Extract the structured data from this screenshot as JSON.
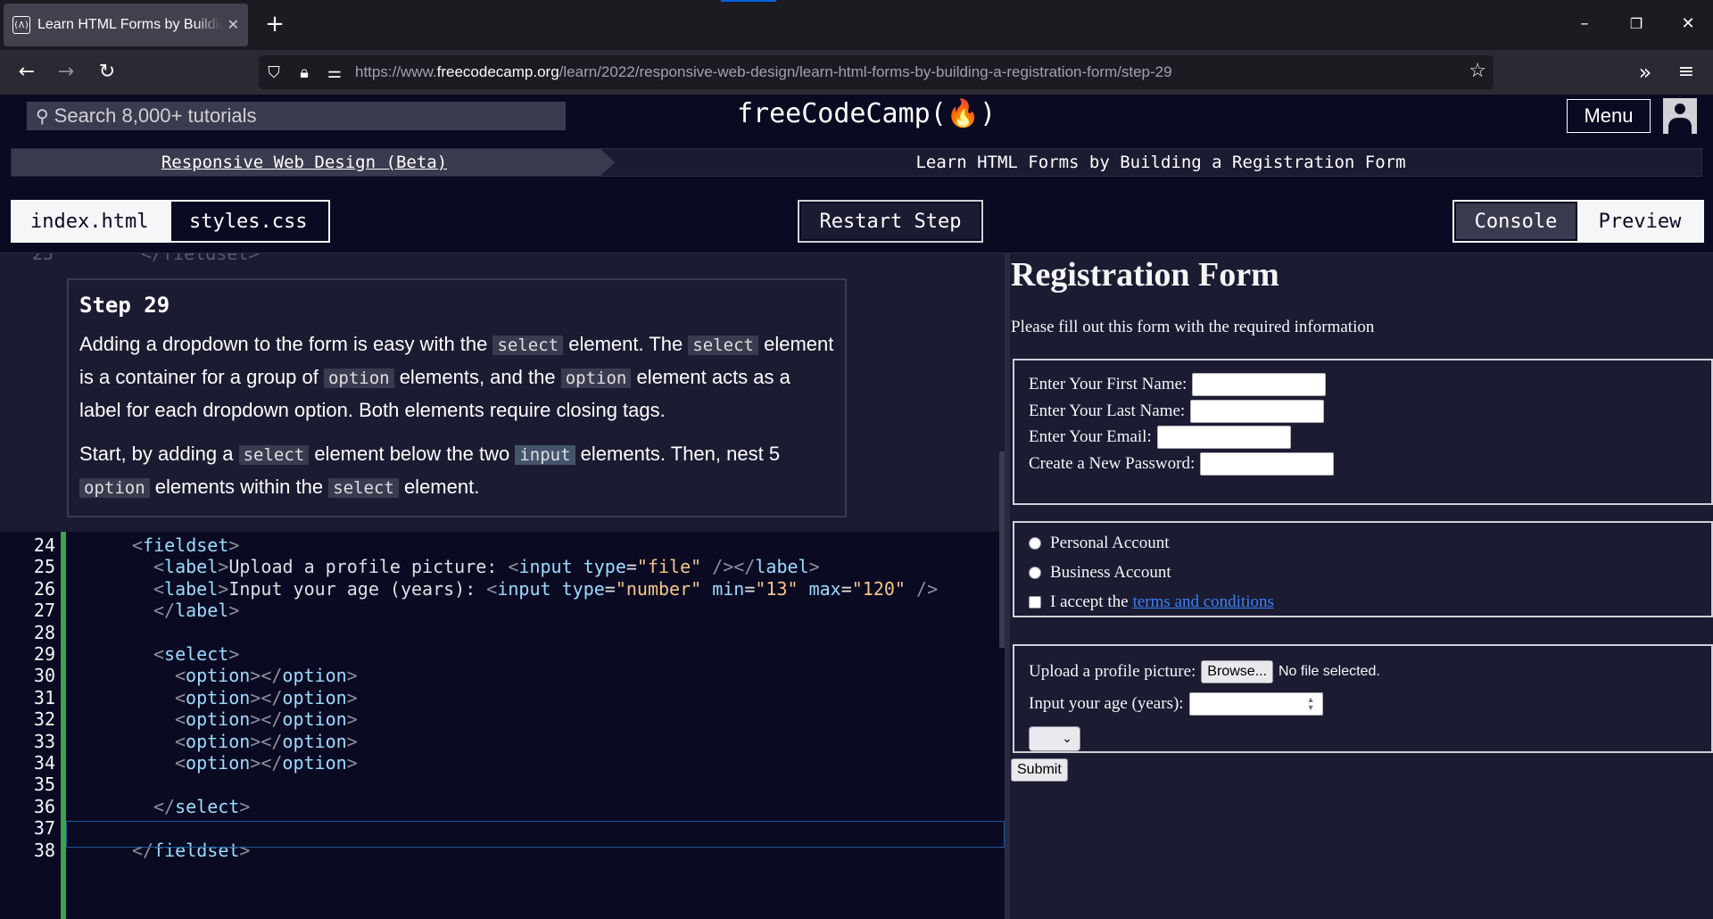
{
  "browser": {
    "tab_title": "Learn HTML Forms by Building a Registration Form",
    "favicon_text": "(Λ)",
    "tab_close_glyph": "✕",
    "new_tab_glyph": "+",
    "url_prefix": "https://www.",
    "url_domain": "freecodecamp.org",
    "url_path": "/learn/2022/responsive-web-design/learn-html-forms-by-building-a-registration-form/step-29"
  },
  "fcc_nav": {
    "search_placeholder": "Search 8,000+ tutorials",
    "logo_text": "freeCodeCamp(🔥)",
    "menu_label": "Menu"
  },
  "breadcrumb": {
    "superblock": "Responsive Web Design (Beta)",
    "block": "Learn HTML Forms by Building a Registration Form"
  },
  "toolbar": {
    "file_tabs": [
      "index.html",
      "styles.css"
    ],
    "active_file": "index.html",
    "restart_label": "Restart Step",
    "console_label": "Console",
    "preview_label": "Preview"
  },
  "instructions": {
    "title": "Step 29",
    "p1": [
      {
        "t": "Adding a dropdown to the form is easy with the "
      },
      {
        "c": "select"
      },
      {
        "t": " element. The "
      },
      {
        "c": "select"
      },
      {
        "t": " element is a container for a group of "
      },
      {
        "c": "option"
      },
      {
        "t": " elements, and the "
      },
      {
        "c": "option"
      },
      {
        "t": " element acts as a label for each dropdown option. Both elements require closing tags."
      }
    ],
    "p2": [
      {
        "t": "Start, by adding a "
      },
      {
        "c": "select"
      },
      {
        "t": " element below the two "
      },
      {
        "c": "input",
        "hl": true
      },
      {
        "t": " elements. Then, nest 5 "
      },
      {
        "c": "option"
      },
      {
        "t": " elements within the "
      },
      {
        "c": "select"
      },
      {
        "t": " element."
      }
    ]
  },
  "editor": {
    "partial_top_line": {
      "num": "23",
      "text": "</fieldset>"
    },
    "lines": [
      {
        "num": "24",
        "indent": 0,
        "tokens": [
          [
            "t-br",
            "<"
          ],
          [
            "t-tag",
            "fieldset"
          ],
          [
            "t-br",
            ">"
          ]
        ]
      },
      {
        "num": "25",
        "indent": 1,
        "tokens": [
          [
            "t-br",
            "<"
          ],
          [
            "t-tag",
            "label"
          ],
          [
            "t-br",
            ">"
          ],
          [
            "t-txt",
            "Upload a profile picture: "
          ],
          [
            "t-br",
            "<"
          ],
          [
            "t-tag",
            "input"
          ],
          [
            "t-txt",
            " "
          ],
          [
            "t-attr",
            "type"
          ],
          [
            "t-txt",
            "="
          ],
          [
            "t-str",
            "\"file\""
          ],
          [
            "t-txt",
            " "
          ],
          [
            "t-br",
            "/></"
          ],
          [
            "t-tag",
            "label"
          ],
          [
            "t-br",
            ">"
          ]
        ]
      },
      {
        "num": "26",
        "indent": 1,
        "tokens": [
          [
            "t-br",
            "<"
          ],
          [
            "t-tag",
            "label"
          ],
          [
            "t-br",
            ">"
          ],
          [
            "t-txt",
            "Input your age (years): "
          ],
          [
            "t-br",
            "<"
          ],
          [
            "t-tag",
            "input"
          ],
          [
            "t-txt",
            " "
          ],
          [
            "t-attr",
            "type"
          ],
          [
            "t-txt",
            "="
          ],
          [
            "t-str",
            "\"number\""
          ],
          [
            "t-txt",
            " "
          ],
          [
            "t-attr",
            "min"
          ],
          [
            "t-txt",
            "="
          ],
          [
            "t-str",
            "\"13\""
          ],
          [
            "t-txt",
            " "
          ],
          [
            "t-attr",
            "max"
          ],
          [
            "t-txt",
            "="
          ],
          [
            "t-str",
            "\"120\""
          ],
          [
            "t-txt",
            " "
          ],
          [
            "t-br",
            "/>"
          ]
        ]
      },
      {
        "num": "27",
        "indent": 1,
        "tokens": [
          [
            "t-br",
            "</"
          ],
          [
            "t-tag",
            "label"
          ],
          [
            "t-br",
            ">"
          ]
        ]
      },
      {
        "num": "28",
        "indent": 0,
        "tokens": []
      },
      {
        "num": "29",
        "indent": 1,
        "tokens": [
          [
            "t-br",
            "<"
          ],
          [
            "t-tag",
            "select"
          ],
          [
            "t-br",
            ">"
          ]
        ]
      },
      {
        "num": "30",
        "indent": 2,
        "tokens": [
          [
            "t-br",
            "<"
          ],
          [
            "t-tag",
            "option"
          ],
          [
            "t-br",
            "></"
          ],
          [
            "t-tag",
            "option"
          ],
          [
            "t-br",
            ">"
          ]
        ]
      },
      {
        "num": "31",
        "indent": 2,
        "tokens": [
          [
            "t-br",
            "<"
          ],
          [
            "t-tag",
            "option"
          ],
          [
            "t-br",
            "></"
          ],
          [
            "t-tag",
            "option"
          ],
          [
            "t-br",
            ">"
          ]
        ]
      },
      {
        "num": "32",
        "indent": 2,
        "tokens": [
          [
            "t-br",
            "<"
          ],
          [
            "t-tag",
            "option"
          ],
          [
            "t-br",
            "></"
          ],
          [
            "t-tag",
            "option"
          ],
          [
            "t-br",
            ">"
          ]
        ]
      },
      {
        "num": "33",
        "indent": 2,
        "tokens": [
          [
            "t-br",
            "<"
          ],
          [
            "t-tag",
            "option"
          ],
          [
            "t-br",
            "></"
          ],
          [
            "t-tag",
            "option"
          ],
          [
            "t-br",
            ">"
          ]
        ]
      },
      {
        "num": "34",
        "indent": 2,
        "tokens": [
          [
            "t-br",
            "<"
          ],
          [
            "t-tag",
            "option"
          ],
          [
            "t-br",
            "></"
          ],
          [
            "t-tag",
            "option"
          ],
          [
            "t-br",
            ">"
          ]
        ]
      },
      {
        "num": "35",
        "indent": 0,
        "tokens": []
      },
      {
        "num": "36",
        "indent": 1,
        "tokens": [
          [
            "t-br",
            "</"
          ],
          [
            "t-tag",
            "select"
          ],
          [
            "t-br",
            ">"
          ]
        ]
      },
      {
        "num": "37",
        "indent": 0,
        "tokens": []
      },
      {
        "num": "38",
        "indent": 0,
        "tokens": [
          [
            "t-br",
            "</"
          ],
          [
            "t-tag",
            "fieldset"
          ],
          [
            "t-br",
            ">"
          ]
        ]
      }
    ]
  },
  "preview": {
    "title": "Registration Form",
    "description": "Please fill out this form with the required information",
    "fieldset1": {
      "first_name_label": "Enter Your First Name:",
      "last_name_label": "Enter Your Last Name:",
      "email_label": "Enter Your Email:",
      "password_label": "Create a New Password:"
    },
    "fieldset2": {
      "personal_label": "Personal Account",
      "business_label": "Business Account",
      "accept_label": "I accept the",
      "terms_link": "terms and conditions"
    },
    "fieldset3": {
      "upload_label": "Upload a profile picture:",
      "browse_label": "Browse...",
      "no_file_text": "No file selected.",
      "age_label": "Input your age (years):"
    },
    "submit_label": "Submit"
  }
}
